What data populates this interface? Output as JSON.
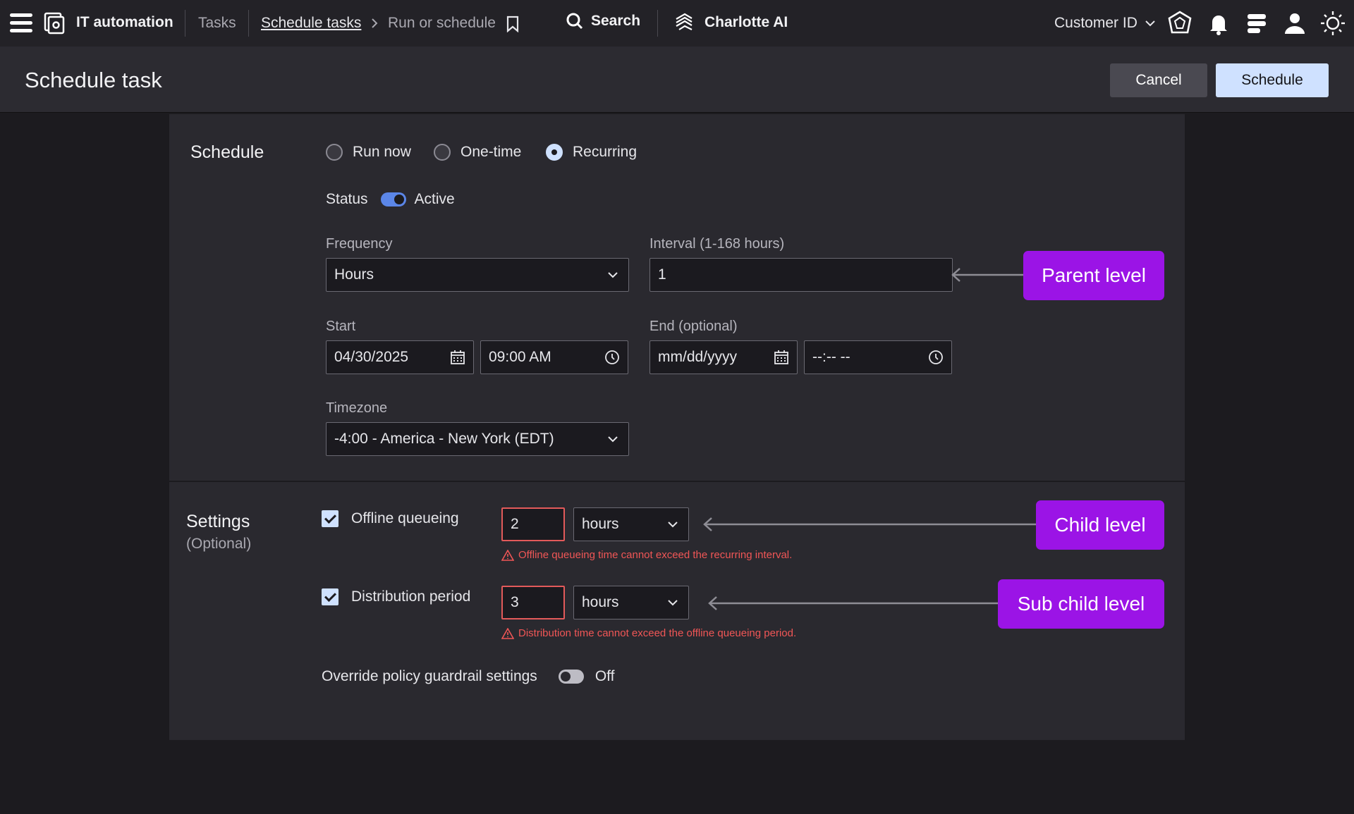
{
  "topbar": {
    "app_title": "IT automation",
    "crumb_tasks": "Tasks",
    "crumb_schedule_tasks": "Schedule tasks",
    "crumb_current": "Run or schedule",
    "search_label": "Search",
    "charlotte_label": "Charlotte AI",
    "customer_label": "Customer ID"
  },
  "header": {
    "title": "Schedule task",
    "cancel_label": "Cancel",
    "schedule_label": "Schedule"
  },
  "schedule": {
    "section_title": "Schedule",
    "radio_run_now": "Run now",
    "radio_one_time": "One-time",
    "radio_recurring": "Recurring",
    "selected": "Recurring",
    "status_label": "Status",
    "status_value": "Active",
    "frequency_label": "Frequency",
    "frequency_value": "Hours",
    "interval_label": "Interval (1-168 hours)",
    "interval_value": "1",
    "start_label": "Start",
    "start_date": "04/30/2025",
    "start_time": "09:00 AM",
    "end_label": "End (optional)",
    "end_date_placeholder": "mm/dd/yyyy",
    "end_time_placeholder": "--:-- --",
    "timezone_label": "Timezone",
    "timezone_value": "-4:00 - America - New York (EDT)"
  },
  "settings": {
    "section_title": "Settings",
    "section_sub": "(Optional)",
    "offline_label": "Offline queueing",
    "offline_value": "2",
    "offline_unit": "hours",
    "offline_error": "Offline queueing time cannot exceed the recurring interval.",
    "distribution_label": "Distribution period",
    "distribution_value": "3",
    "distribution_unit": "hours",
    "distribution_error": "Distribution time cannot exceed the offline queueing period.",
    "override_label": "Override policy guardrail settings",
    "override_value": "Off"
  },
  "callouts": {
    "parent": "Parent level",
    "child": "Child level",
    "sub_child": "Sub child level"
  },
  "colors": {
    "accent": "#cfe1ff",
    "callout": "#9b14e6",
    "error": "#f05656",
    "toggle_on": "#5b86e8"
  }
}
